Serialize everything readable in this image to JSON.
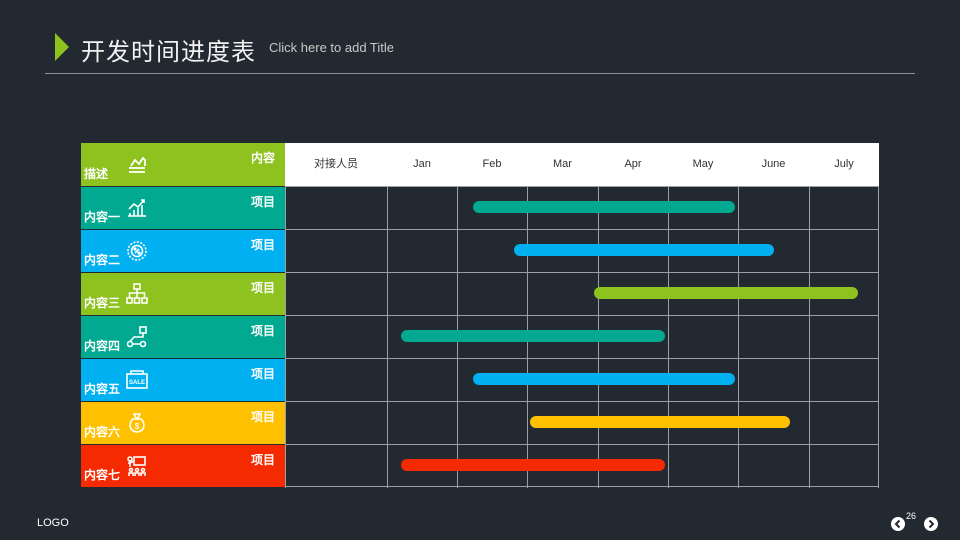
{
  "header": {
    "title": "开发时间进度表",
    "subtitle": "Click here to add Title"
  },
  "table": {
    "corner_label": "描述",
    "corner_tag": "内容",
    "columns": [
      "对接人员",
      "Jan",
      "Feb",
      "Mar",
      "Apr",
      "May",
      "June",
      "July"
    ],
    "rows": [
      {
        "label": "内容一",
        "tag": "项目",
        "color": "#00a98f",
        "icon": "chart-up-icon",
        "bar_start": 1.23,
        "bar_end": 4.95
      },
      {
        "label": "内容二",
        "tag": "项目",
        "color": "#00b0f0",
        "icon": "percent-badge-icon",
        "bar_start": 1.8,
        "bar_end": 5.5
      },
      {
        "label": "内容三",
        "tag": "项目",
        "color": "#8dc21f",
        "icon": "org-chart-icon",
        "bar_start": 2.95,
        "bar_end": 6.7
      },
      {
        "label": "内容四",
        "tag": "项目",
        "color": "#00a98f",
        "icon": "workflow-icon",
        "bar_start": 0.2,
        "bar_end": 3.95
      },
      {
        "label": "内容五",
        "tag": "项目",
        "color": "#00b0f0",
        "icon": "sale-sign-icon",
        "bar_start": 1.23,
        "bar_end": 4.95
      },
      {
        "label": "内容六",
        "tag": "项目",
        "color": "#ffc000",
        "icon": "money-bag-icon",
        "bar_start": 2.03,
        "bar_end": 5.73
      },
      {
        "label": "内容七",
        "tag": "项目",
        "color": "#f52a00",
        "icon": "team-board-icon",
        "bar_start": 0.2,
        "bar_end": 3.95
      }
    ],
    "header_color": "#8dc21f"
  },
  "colors": {
    "accent": "#8dc21f",
    "background": "#232930",
    "bar_teal": "#00a98f",
    "bar_blue": "#00b0f0",
    "bar_green": "#8dc21f",
    "bar_yellow": "#ffc000",
    "bar_red": "#f52a00"
  },
  "footer": {
    "logo": "LOGO",
    "page_number": "26"
  }
}
